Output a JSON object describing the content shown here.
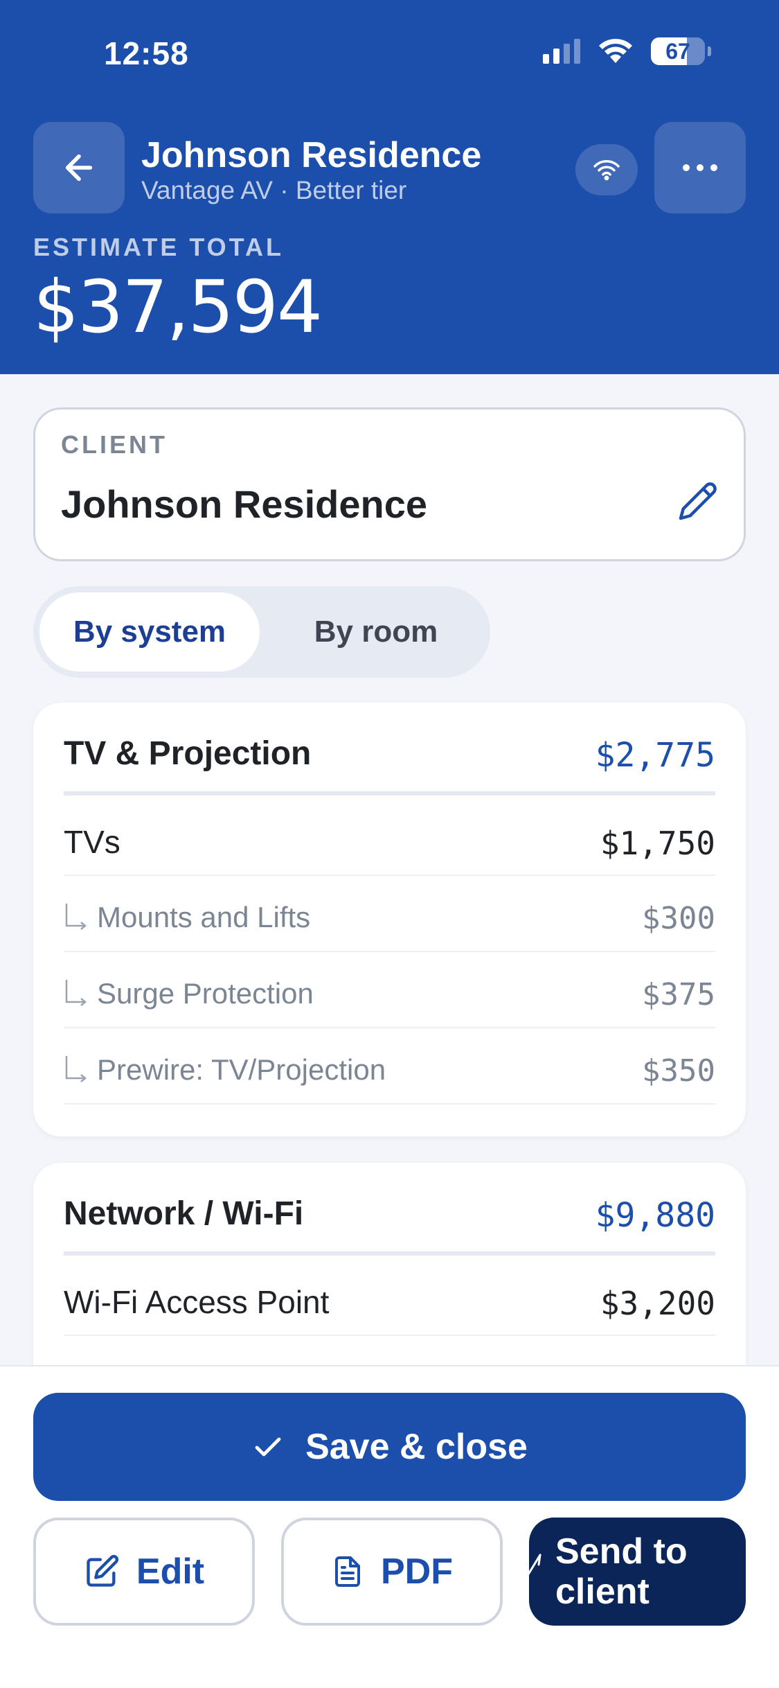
{
  "status_bar": {
    "time": "12:58",
    "battery": "67"
  },
  "header": {
    "title": "Johnson Residence",
    "subtitle": "Vantage AV · Better tier",
    "estimate_label": "ESTIMATE TOTAL",
    "estimate_total": "$37,594"
  },
  "client": {
    "label": "CLIENT",
    "name": "Johnson Residence"
  },
  "view_toggle": {
    "active": "By system",
    "inactive": "By room"
  },
  "sections": [
    {
      "title": "TV & Projection",
      "amount": "$2,775",
      "rows": [
        {
          "label": "TVs",
          "amount": "$1,750"
        },
        {
          "label": "Mounts and Lifts",
          "amount": "$300"
        },
        {
          "label": "Surge Protection",
          "amount": "$375"
        },
        {
          "label": "Prewire: TV/Projection",
          "amount": "$350"
        }
      ]
    },
    {
      "title": "Network / Wi-Fi",
      "amount": "$9,880",
      "rows": [
        {
          "label": "Wi-Fi Access Point",
          "amount": "$3,200"
        }
      ]
    }
  ],
  "actions": {
    "save": "Save & close",
    "edit": "Edit",
    "pdf": "PDF",
    "send": "Send to client"
  },
  "colors": {
    "primary": "#1c4eab",
    "dark": "#0c2558",
    "background": "#f3f5fa"
  }
}
